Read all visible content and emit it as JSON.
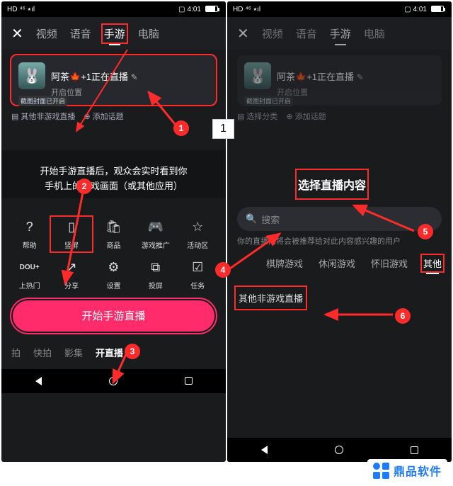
{
  "status": {
    "hd": "HD",
    "net": "4G",
    "sig": "⁴⁶ ٭ıl",
    "time": "4:01"
  },
  "tabs": [
    "视频",
    "语音",
    "手游",
    "电脑"
  ],
  "close": "✕",
  "profile": {
    "name_prefix": "阿茶",
    "leaf": "🍁",
    "plus": "+1",
    "live": "正在直播",
    "cover_badge": "截图封面已开启",
    "sub": "开启位置"
  },
  "chips_left": {
    "cat": "其他非游戏直播",
    "topic": "添加话题"
  },
  "chips_right": {
    "cat": "选择分类",
    "topic": "添加话题"
  },
  "desc1": "开始手游直播后，观众会实时看到你",
  "desc2": "手机上的游戏画面（或其他应用）",
  "grid1": [
    {
      "icon": "?",
      "label": "帮助"
    },
    {
      "icon": "▯",
      "label": "竖屏"
    },
    {
      "icon": "🛍",
      "label": "商品"
    },
    {
      "icon": "🎮",
      "label": "游戏推广"
    },
    {
      "icon": "☆",
      "label": "活动区"
    }
  ],
  "grid2": [
    {
      "icon": "DOU+",
      "label": "上热门"
    },
    {
      "icon": "↗",
      "label": "分享"
    },
    {
      "icon": "⚙",
      "label": "设置"
    },
    {
      "icon": "⧉",
      "label": "投屏"
    },
    {
      "icon": "☑",
      "label": "任务"
    }
  ],
  "start_btn": "开始手游直播",
  "bottom_tabs": [
    "拍",
    "快拍",
    "影集",
    "开直播"
  ],
  "dialog_title": "选择直播内容",
  "search_ph": "搜索",
  "hint": "你的直播间将会被推荐给对此内容感兴趣的用户",
  "cats": [
    "棋牌游戏",
    "休闲游戏",
    "怀旧游戏",
    "其他"
  ],
  "other_item": "其他非游戏直播",
  "markers": {
    "1": "1",
    "2": "2",
    "3": "3",
    "4": "4",
    "5": "5",
    "6": "6",
    "one": "1"
  },
  "watermark": "鼎品软件"
}
